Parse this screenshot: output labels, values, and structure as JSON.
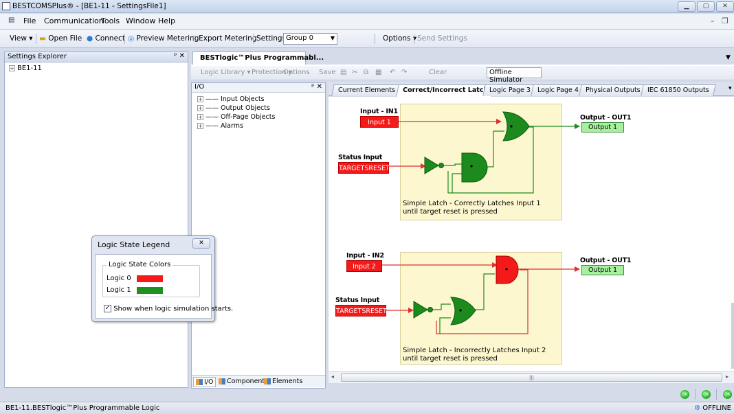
{
  "window": {
    "title": "BESTCOMSPlus® - [BE1-11 - SettingsFile1]"
  },
  "menu": [
    "File",
    "Communication",
    "Tools",
    "Window",
    "Help"
  ],
  "toolbar": {
    "view": "View",
    "open_file": "Open File",
    "connect": "Connect",
    "preview_metering": "Preview Metering",
    "export_metering": "Export Metering",
    "settings": "Settings",
    "settings_group": "Group 0",
    "options": "Options",
    "send_settings": "Send Settings"
  },
  "settings_explorer": {
    "title": "Settings Explorer",
    "pin_close": "ᵖ ✕",
    "root": "BE1-11"
  },
  "legend_dialog": {
    "title": "Logic State Legend",
    "group_title": "Logic State Colors",
    "logic0_label": "Logic 0",
    "logic1_label": "Logic 1",
    "logic0_color": "#f41a1a",
    "logic1_color": "#1f8f1f",
    "show_checkbox_label": "Show when logic simulation starts.",
    "show_checked": true
  },
  "document": {
    "tab_title": "BESTlogic™Plus Programmabl...",
    "logic_toolbar": {
      "logic_library": "Logic Library",
      "protection": "Protection",
      "options": "Options",
      "save": "Save",
      "clear": "Clear",
      "offline_simulator": "Offline Simulator"
    }
  },
  "io_panel": {
    "title": "I/O",
    "items": [
      "Input Objects",
      "Output Objects",
      "Off-Page Objects",
      "Alarms"
    ],
    "tabs": [
      "I/O",
      "Components",
      "Elements"
    ]
  },
  "page_tabs": [
    "Current Elements",
    "Correct/Incorrect Latch",
    "Logic Page 3",
    "Logic Page 4",
    "Physical Outputs",
    "IEC 61850 Outputs"
  ],
  "active_page_tab": "Correct/Incorrect Latch",
  "diagram": {
    "latch1": {
      "input_header": "Input - IN1",
      "input_label": "Input 1",
      "status_header": "Status Input",
      "status_label": "TARGETSRESET",
      "output_header": "Output - OUT1",
      "output_label": "Output 1",
      "desc_line1": "Simple Latch - Correctly Latches Input 1",
      "desc_line2": "until target reset is pressed"
    },
    "latch2": {
      "input_header": "Input - IN2",
      "input_label": "Input 2",
      "status_header": "Status Input",
      "status_label": "TARGETSRESET",
      "output_header": "Output - OUT1",
      "output_label": "Output 1",
      "desc_line1": "Simple Latch - Incorrectly Latches Input 2",
      "desc_line2": "until target reset is pressed"
    }
  },
  "statusbar": {
    "text": "BE1-11.BESTlogic™Plus Programmable Logic",
    "offline": "OFFLINE"
  }
}
